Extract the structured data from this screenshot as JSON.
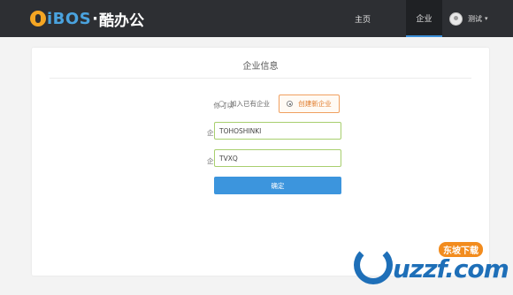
{
  "brand": {
    "logo_text": "iBOS",
    "logo_dot": "·",
    "logo_cn": "酷办公"
  },
  "nav": {
    "home": "主页",
    "enterprise": "企业"
  },
  "user": {
    "name": "测试",
    "caret": "▾"
  },
  "card": {
    "title": "企业信息",
    "choice_label": "你可以",
    "options": [
      {
        "label": "加入已有企业",
        "selected": false
      },
      {
        "label": "创建新企业",
        "selected": true
      }
    ],
    "short_name_label": "企业简称",
    "short_name_value": "TOHOSHINKI",
    "code_label": "企业代码",
    "code_value": "TVXQ",
    "confirm_label": "确定"
  },
  "watermark": {
    "text": "uzzf.com",
    "badge": "东坡下载"
  },
  "colors": {
    "topbar": "#2d2f33",
    "accent": "#3c95dd",
    "selected_option": "#f0a060",
    "field_border": "#a8cf6e"
  }
}
